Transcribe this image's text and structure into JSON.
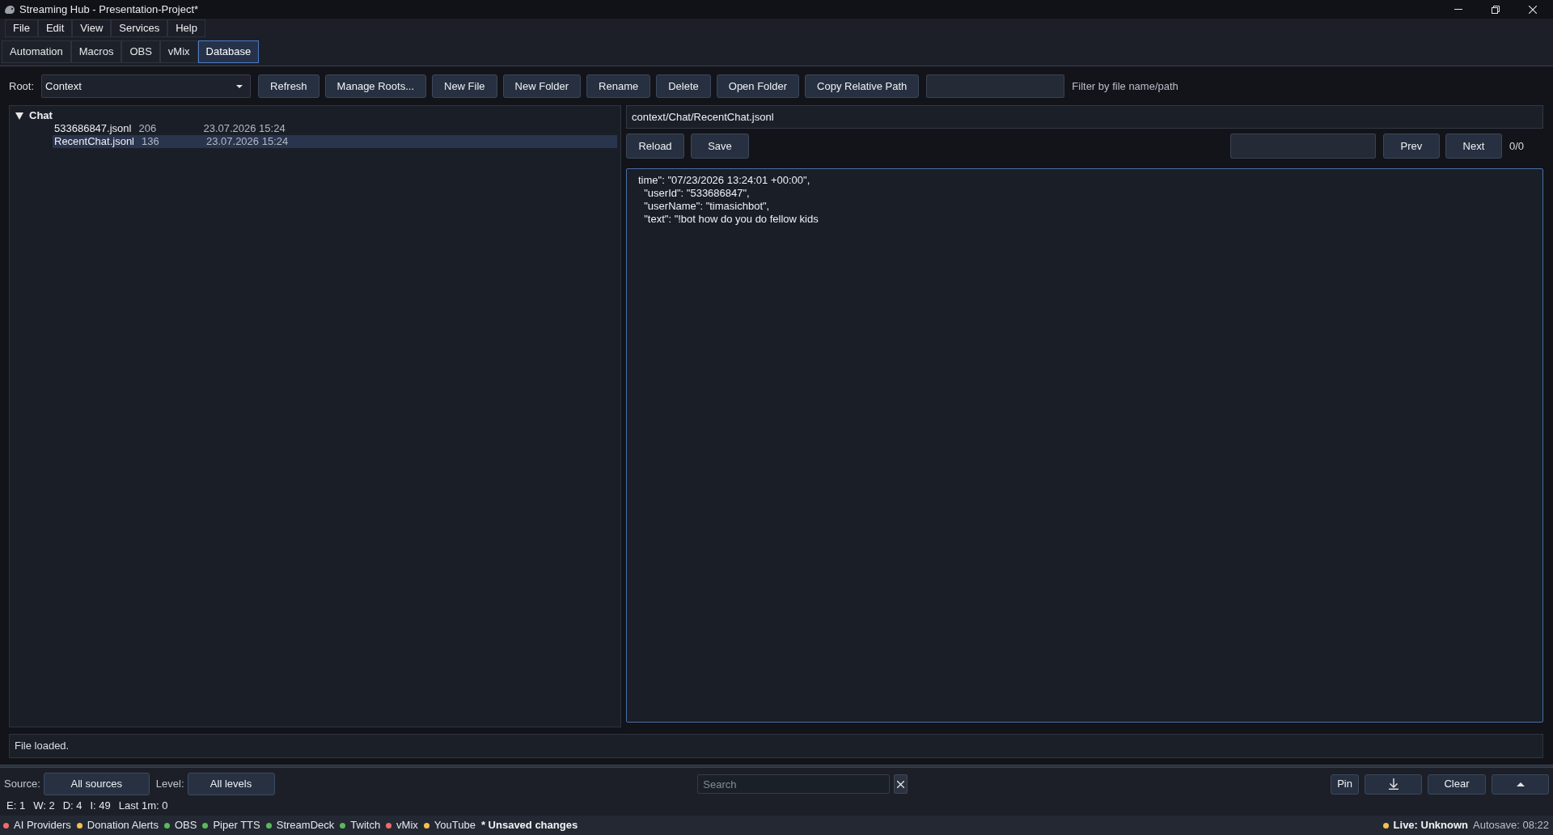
{
  "window": {
    "title": "Streaming Hub - Presentation-Project*"
  },
  "menu": [
    "File",
    "Edit",
    "View",
    "Services",
    "Help"
  ],
  "tabs": [
    {
      "label": "Automation",
      "selected": false
    },
    {
      "label": "Macros",
      "selected": false
    },
    {
      "label": "OBS",
      "selected": false
    },
    {
      "label": "vMix",
      "selected": false
    },
    {
      "label": "Database",
      "selected": true
    }
  ],
  "toolbar": {
    "root_label": "Root:",
    "root_value": "Context",
    "buttons": [
      "Refresh",
      "Manage Roots...",
      "New File",
      "New Folder",
      "Rename",
      "Delete",
      "Open Folder",
      "Copy Relative Path"
    ],
    "filter_label": "Filter by file name/path"
  },
  "tree": [
    {
      "label": "Chat",
      "expanded": true,
      "children": [
        {
          "name": "533686847.jsonl",
          "size": "206",
          "modified": "23.07.2026 15:24",
          "selected": false
        },
        {
          "name": "RecentChat.jsonl",
          "size": "136",
          "modified": "23.07.2026 15:24",
          "selected": true
        }
      ]
    }
  ],
  "editor": {
    "path": "context/Chat/RecentChat.jsonl",
    "buttons": [
      "Reload",
      "Save"
    ],
    "nav_buttons": [
      "Prev",
      "Next"
    ],
    "match_count": "0/0",
    "lines": [
      "time\": \"07/23/2026 13:24:01 +00:00\",",
      "  \"userId\": \"533686847\",",
      "  \"userName\": \"timasichbot\",",
      "  \"text\": \"!bot how do you do fellow kids"
    ]
  },
  "status_message": "File loaded.",
  "log_panel": {
    "source_label": "Source:",
    "source_value": "All sources",
    "level_label": "Level:",
    "level_value": "All levels",
    "search": {
      "placeholder": "Search"
    },
    "buttons": [
      {
        "kind": "text",
        "label": "Pin"
      },
      {
        "kind": "download"
      },
      {
        "kind": "text",
        "label": "Clear"
      },
      {
        "kind": "collapse"
      }
    ],
    "stats": [
      "E: 1",
      "W: 2",
      "D: 4",
      "I: 49",
      "Last 1m: 0"
    ]
  },
  "status_bar": {
    "services": [
      {
        "name": "AI Providers",
        "color": "#ef6b6b"
      },
      {
        "name": "Donation Alerts",
        "color": "#f2c14e"
      },
      {
        "name": "OBS",
        "color": "#5cb85c"
      },
      {
        "name": "Piper TTS",
        "color": "#5cb85c"
      },
      {
        "name": "StreamDeck",
        "color": "#5cb85c"
      },
      {
        "name": "Twitch",
        "color": "#5cb85c"
      },
      {
        "name": "vMix",
        "color": "#ef6b6b"
      },
      {
        "name": "YouTube",
        "color": "#f2c14e"
      }
    ],
    "unsaved": "* Unsaved changes",
    "live": {
      "label": "Live: Unknown",
      "color": "#f2c14e"
    },
    "autosave": "Autosave: 08:22"
  }
}
